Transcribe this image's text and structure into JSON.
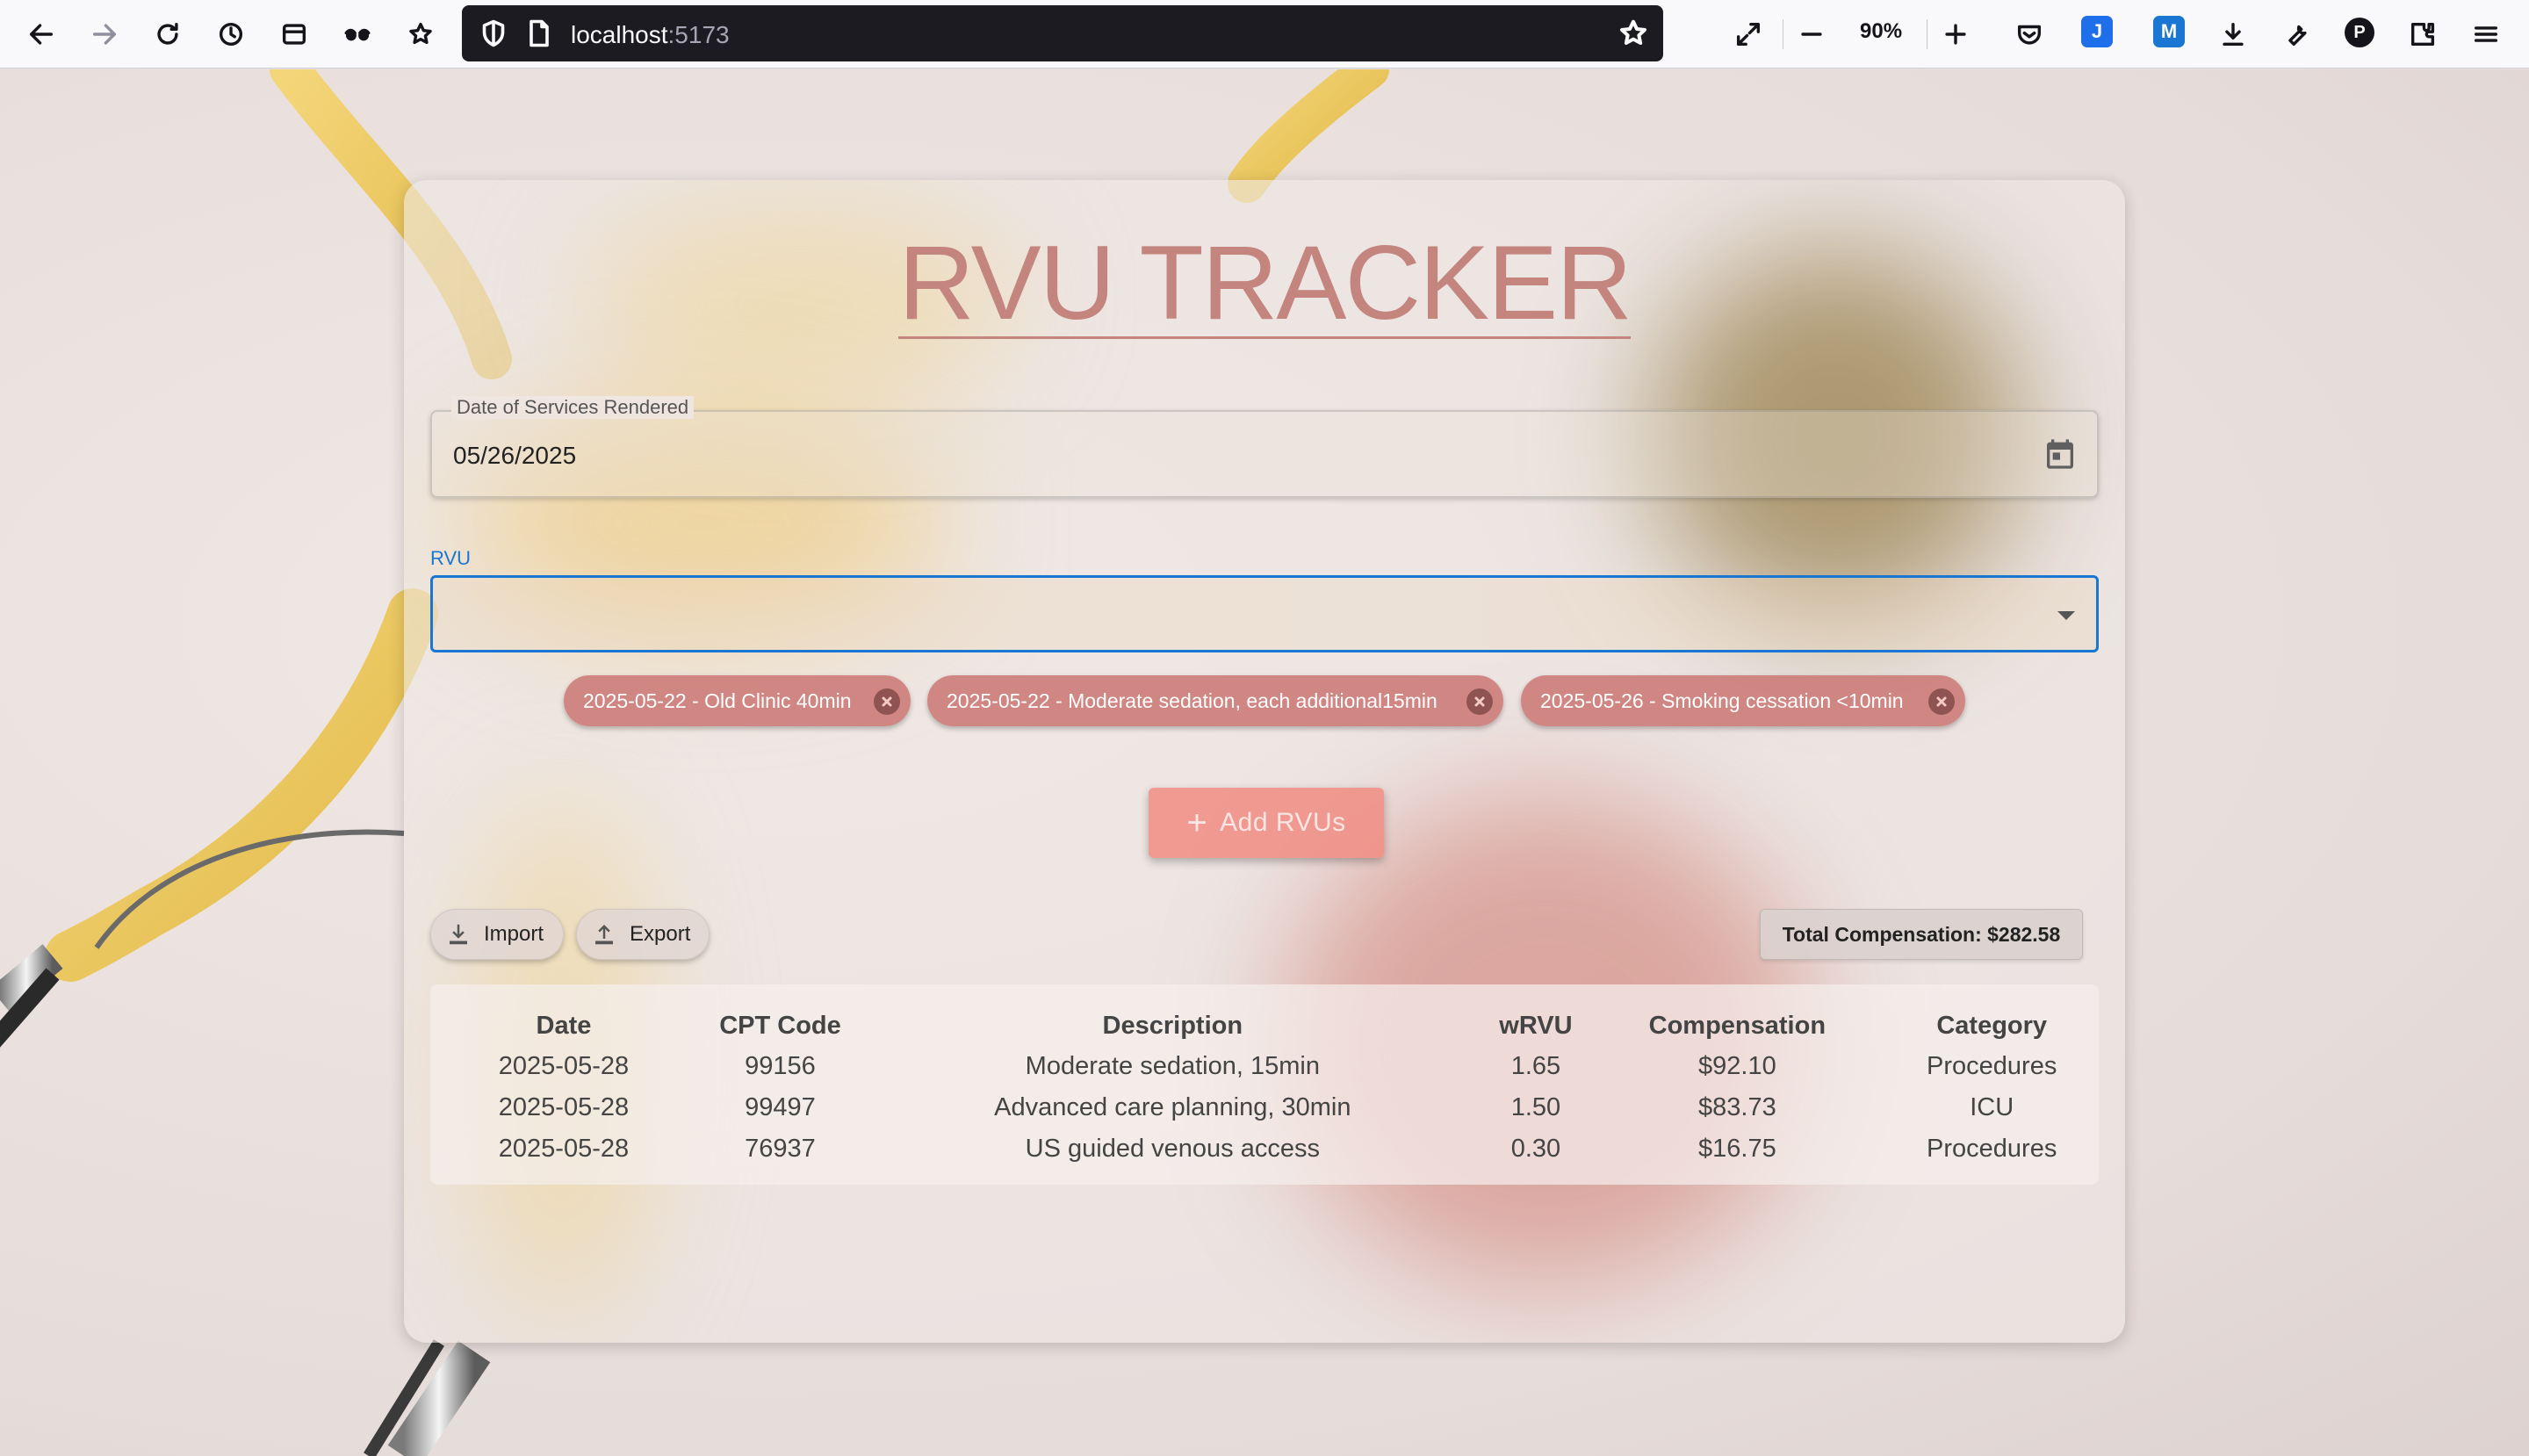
{
  "browser": {
    "url_host": "localhost",
    "url_port": ":5173",
    "zoom": "90%"
  },
  "app": {
    "title": "RVU TRACKER",
    "date_field": {
      "label": "Date of Services Rendered",
      "value": "05/26/2025"
    },
    "rvu_field": {
      "label": "RVU",
      "value": ""
    },
    "chips": [
      {
        "label": "2025-05-22 - Old Clinic 40min"
      },
      {
        "label": "2025-05-22 - Moderate sedation, each additional15min"
      },
      {
        "label": "2025-05-26 - Smoking cessation <10min"
      }
    ],
    "add_button": "Add RVUs",
    "import_button": "Import",
    "export_button": "Export",
    "total_compensation": "Total Compensation: $282.58",
    "table": {
      "headers": [
        "Date",
        "CPT Code",
        "Description",
        "wRVU",
        "Compensation",
        "Category"
      ],
      "rows": [
        [
          "2025-05-28",
          "99156",
          "Moderate sedation, 15min",
          "1.65",
          "$92.10",
          "Procedures"
        ],
        [
          "2025-05-28",
          "99497",
          "Advanced care planning, 30min",
          "1.50",
          "$83.73",
          "ICU"
        ],
        [
          "2025-05-28",
          "76937",
          "US guided venous access",
          "0.30",
          "$16.75",
          "Procedures"
        ]
      ]
    }
  },
  "colors": {
    "title": "#c4857f",
    "chip": "#cc7a76",
    "accent_blue": "#1976d2",
    "add_button": "#f08c82"
  },
  "icons": [
    "back-icon",
    "forward-icon",
    "reload-icon",
    "history-icon",
    "sidebar-icon",
    "private-mask-icon",
    "bookmark-star-icon",
    "shield-icon",
    "page-icon",
    "star-icon",
    "fullscreen-icon",
    "zoom-out-icon",
    "zoom-in-icon",
    "pocket-icon",
    "download-icon",
    "wrench-icon",
    "profile-icon",
    "extensions-icon",
    "menu-icon",
    "calendar-icon",
    "dropdown-caret-icon",
    "close-circle-icon",
    "plus-icon",
    "import-icon",
    "export-icon"
  ]
}
